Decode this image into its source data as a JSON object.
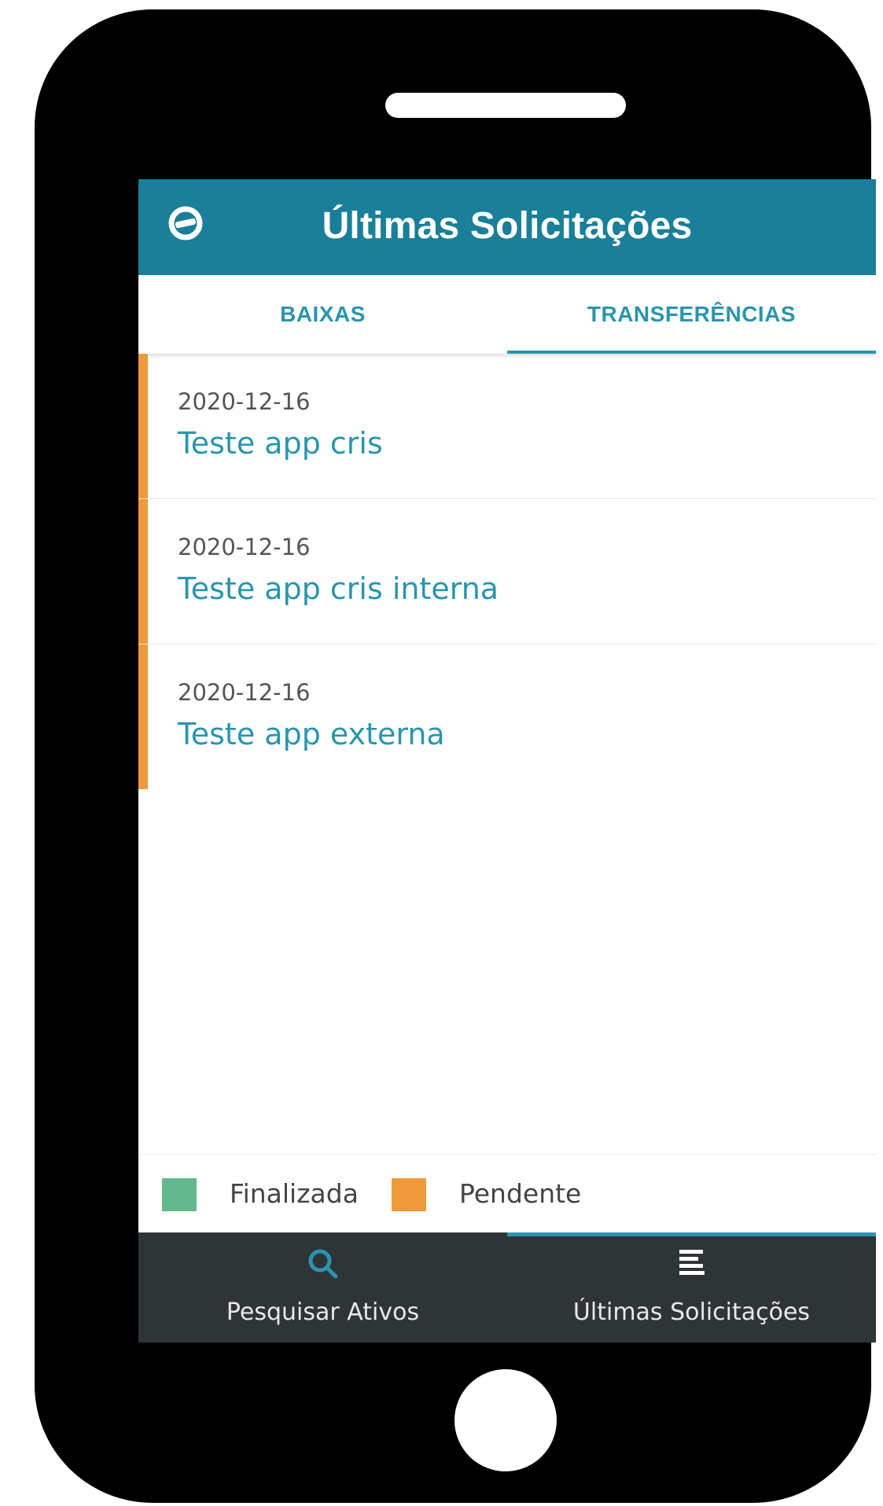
{
  "header": {
    "title": "Últimas Solicitações",
    "logo_icon": "totvs-logo-icon",
    "color": "#1a7f99"
  },
  "tabs": [
    {
      "label": "BAIXAS",
      "selected": false
    },
    {
      "label": "TRANSFERÊNCIAS",
      "selected": true
    }
  ],
  "items": [
    {
      "date": "2020-12-16",
      "title": "Teste app cris",
      "status": "Pendente"
    },
    {
      "date": "2020-12-16",
      "title": "Teste app cris interna",
      "status": "Pendente"
    },
    {
      "date": "2020-12-16",
      "title": "Teste app externa",
      "status": "Pendente"
    }
  ],
  "legend": {
    "finalizada": {
      "label": "Finalizada",
      "color": "#64b88e"
    },
    "pendente": {
      "label": "Pendente",
      "color": "#ee9a3b"
    }
  },
  "bottom_nav": [
    {
      "label": "Pesquisar Ativos",
      "icon": "search-icon",
      "selected": false
    },
    {
      "label": "Últimas Solicitações",
      "icon": "list-icon",
      "selected": true
    }
  ],
  "accent_color": "#2a95ad"
}
